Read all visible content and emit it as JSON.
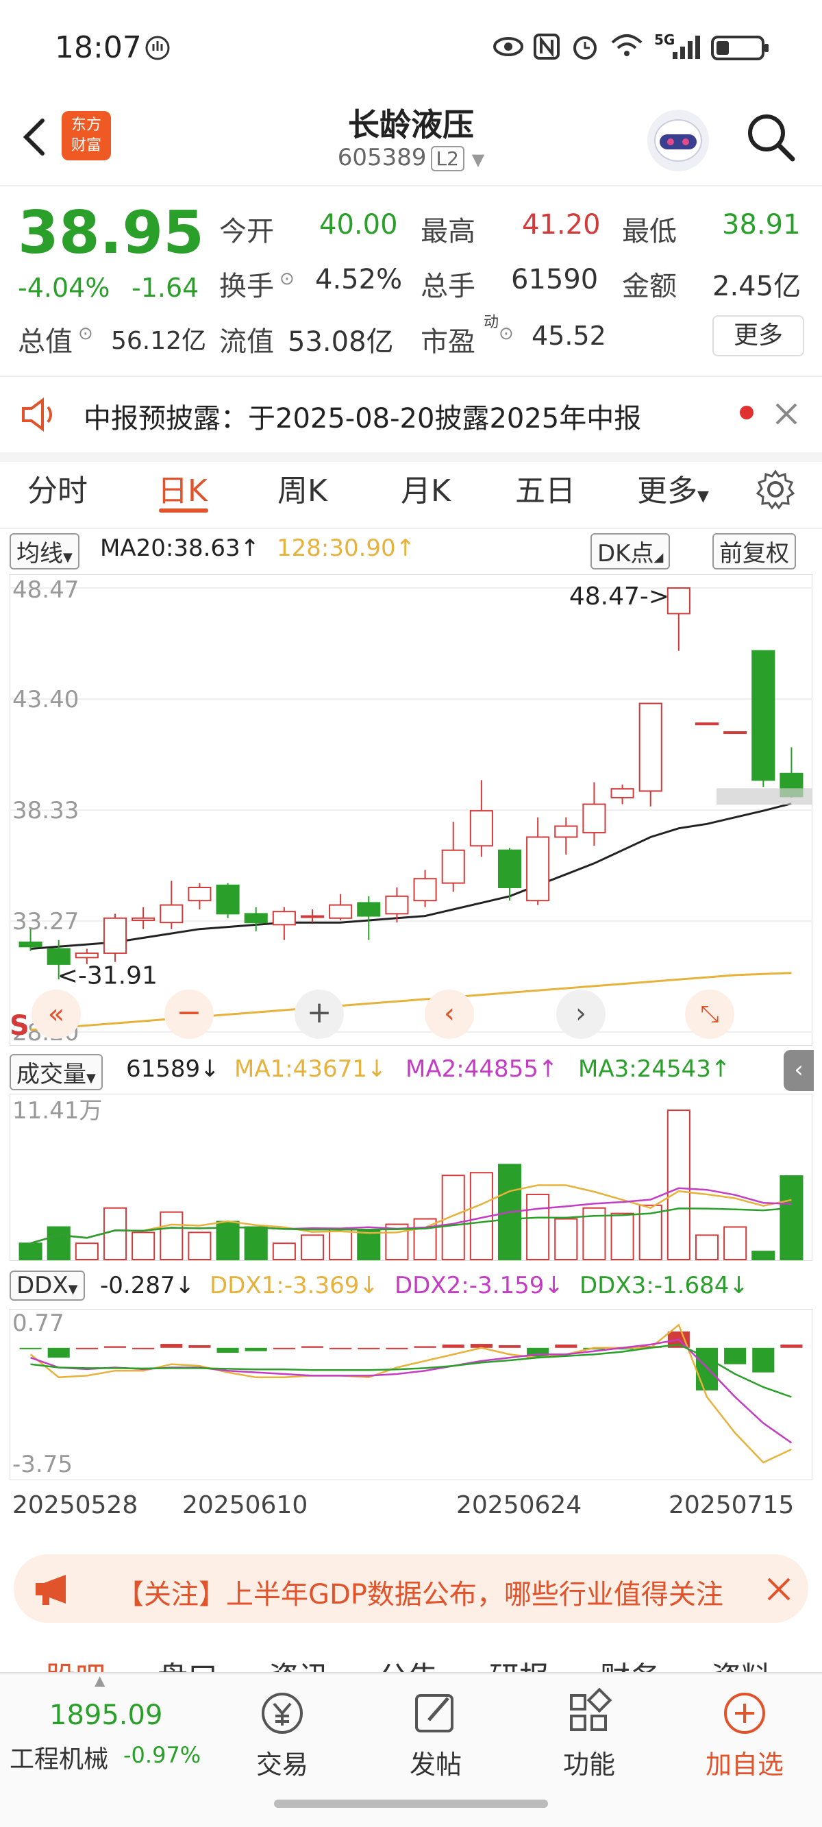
{
  "status_bar": {
    "time": "18:07",
    "network": "5G"
  },
  "header": {
    "logo_text_1": "东方",
    "logo_text_2": "财富",
    "stock_name": "长龄液压",
    "stock_code": "605389",
    "level_badge": "L2"
  },
  "quote": {
    "price": "38.95",
    "change_pct": "-4.04%",
    "change_abs": "-1.64",
    "open_label": "今开",
    "open": "40.00",
    "high_label": "最高",
    "high": "41.20",
    "low_label": "最低",
    "low": "38.91",
    "turnover_label": "换手",
    "turnover": "4.52%",
    "volume_label": "总手",
    "volume": "61590",
    "amount_label": "金额",
    "amount": "2.45亿",
    "mktcap_label": "总值",
    "mktcap": "56.12亿",
    "float_label": "流值",
    "float_cap": "53.08亿",
    "pe_label": "市盈",
    "pe_sup": "动",
    "pe": "45.52",
    "more_label": "更多"
  },
  "notice": {
    "text": "中报预披露：于2025-08-20披露2025年中报"
  },
  "tabs": [
    "分时",
    "日K",
    "周K",
    "月K",
    "五日",
    "更多"
  ],
  "chart_toolbar": {
    "ma_select": "均线",
    "ma20": "MA20:38.63↑",
    "ma128": "128:30.90↑",
    "dk_label": "DK点",
    "adjust_label": "前复权"
  },
  "chart_data": [
    {
      "type": "candlestick",
      "y_ticks": [
        "48.47",
        "43.40",
        "38.33",
        "33.27",
        "28.20"
      ],
      "ylim": [
        28.2,
        48.47
      ],
      "max_label": "48.47->",
      "min_label": "<-31.91",
      "candles": [
        {
          "o": 32.3,
          "c": 32.1,
          "h": 32.9,
          "l": 31.9
        },
        {
          "o": 32.0,
          "c": 31.3,
          "h": 32.4,
          "l": 30.6
        },
        {
          "o": 31.6,
          "c": 31.8,
          "h": 32.0,
          "l": 31.3
        },
        {
          "o": 31.8,
          "c": 33.4,
          "h": 33.6,
          "l": 31.4
        },
        {
          "o": 33.3,
          "c": 33.4,
          "h": 33.9,
          "l": 32.9
        },
        {
          "o": 33.2,
          "c": 34.0,
          "h": 35.1,
          "l": 32.9
        },
        {
          "o": 34.2,
          "c": 34.8,
          "h": 35.0,
          "l": 33.8
        },
        {
          "o": 34.9,
          "c": 33.6,
          "h": 35.0,
          "l": 33.4
        },
        {
          "o": 33.6,
          "c": 33.2,
          "h": 33.9,
          "l": 32.8
        },
        {
          "o": 33.1,
          "c": 33.7,
          "h": 33.9,
          "l": 32.4
        },
        {
          "o": 33.5,
          "c": 33.5,
          "h": 33.8,
          "l": 33.2
        },
        {
          "o": 33.4,
          "c": 34.0,
          "h": 34.5,
          "l": 33.3
        },
        {
          "o": 34.1,
          "c": 33.5,
          "h": 34.4,
          "l": 32.4
        },
        {
          "o": 33.6,
          "c": 34.4,
          "h": 34.8,
          "l": 33.2
        },
        {
          "o": 34.2,
          "c": 35.2,
          "h": 35.6,
          "l": 33.9
        },
        {
          "o": 35.0,
          "c": 36.5,
          "h": 37.8,
          "l": 34.6
        },
        {
          "o": 36.7,
          "c": 38.3,
          "h": 39.7,
          "l": 36.2
        },
        {
          "o": 36.5,
          "c": 34.8,
          "h": 36.6,
          "l": 34.2
        },
        {
          "o": 34.2,
          "c": 37.1,
          "h": 38.0,
          "l": 34.0
        },
        {
          "o": 37.1,
          "c": 37.6,
          "h": 38.0,
          "l": 36.3
        },
        {
          "o": 37.3,
          "c": 38.6,
          "h": 39.6,
          "l": 36.7
        },
        {
          "o": 38.9,
          "c": 39.3,
          "h": 39.5,
          "l": 38.6
        },
        {
          "o": 39.2,
          "c": 43.2,
          "h": 43.2,
          "l": 38.5
        },
        {
          "o": 47.3,
          "c": 48.47,
          "h": 48.47,
          "l": 45.6
        },
        {
          "o": 42.3,
          "c": 42.3,
          "h": 42.3,
          "l": 42.3
        },
        {
          "o": 41.9,
          "c": 41.9,
          "h": 41.9,
          "l": 41.9
        },
        {
          "o": 45.6,
          "c": 39.7,
          "h": 45.6,
          "l": 39.4
        },
        {
          "o": 40.0,
          "c": 38.95,
          "h": 41.2,
          "l": 38.9
        }
      ],
      "ma20": [
        32.0,
        32.1,
        32.2,
        32.3,
        32.5,
        32.7,
        32.9,
        33.0,
        33.1,
        33.2,
        33.2,
        33.2,
        33.3,
        33.4,
        33.5,
        33.8,
        34.1,
        34.4,
        34.9,
        35.4,
        35.9,
        36.5,
        37.1,
        37.5,
        37.7,
        38.0,
        38.3,
        38.63
      ],
      "ma128": [
        28.3,
        28.4,
        28.5,
        28.6,
        28.7,
        28.8,
        28.9,
        29.0,
        29.1,
        29.2,
        29.3,
        29.4,
        29.5,
        29.6,
        29.7,
        29.8,
        29.9,
        30.0,
        30.1,
        30.2,
        30.3,
        30.4,
        30.5,
        30.6,
        30.7,
        30.8,
        30.85,
        30.9
      ]
    },
    {
      "type": "bar",
      "label": "成交量",
      "y_top_label": "11.41万",
      "ylim": [
        0,
        114100
      ],
      "values": [
        12000,
        24000,
        12000,
        38000,
        20000,
        35000,
        20000,
        28000,
        24000,
        12000,
        18000,
        22000,
        22000,
        26000,
        30000,
        62000,
        64000,
        70000,
        48000,
        30000,
        38000,
        34000,
        40000,
        110000,
        18000,
        24000,
        6000,
        61589
      ]
    },
    {
      "type": "bar",
      "label": "DDX",
      "y_ticks": [
        "0.77",
        "-3.75"
      ],
      "ylim": [
        -3.75,
        0.77
      ],
      "values": [
        -0.02,
        -0.3,
        0.0,
        0.05,
        0.0,
        0.12,
        0.08,
        -0.15,
        -0.1,
        0.0,
        0.05,
        0.0,
        0.0,
        0.0,
        0.05,
        0.1,
        0.12,
        0.08,
        -0.3,
        0.1,
        -0.05,
        -0.05,
        0.05,
        0.5,
        -1.3,
        -0.5,
        -0.75,
        0.1,
        -0.287
      ]
    }
  ],
  "volume_toolbar": {
    "label": "成交量",
    "value": "61589↓",
    "ma1": "MA1:43671↓",
    "ma2": "MA2:44855↑",
    "ma3": "MA3:24543↑"
  },
  "ddx_toolbar": {
    "label": "DDX",
    "value": "-0.287↓",
    "ddx1": "DDX1:-3.369↓",
    "ddx2": "DDX2:-3.159↓",
    "ddx3": "DDX3:-1.684↓"
  },
  "x_dates": [
    "20250528",
    "20250610",
    "20250624",
    "20250715"
  ],
  "banner": {
    "text": "【关注】上半年GDP数据公布，哪些行业值得关注"
  },
  "bottom_tabs": [
    "股吧",
    "盘口",
    "资讯",
    "公告",
    "研报",
    "财务",
    "资料"
  ],
  "bottom_bar": {
    "index_value": "1895.09",
    "index_name": "工程机械",
    "index_change": "-0.97%",
    "trade": "交易",
    "post": "发帖",
    "function": "功能",
    "add_watch": "加自选"
  },
  "colors": {
    "up": "#d33a3a",
    "down": "#2aa02a",
    "accent": "#e0532b",
    "ma20": "#222222",
    "ma128": "#e6b23c"
  }
}
